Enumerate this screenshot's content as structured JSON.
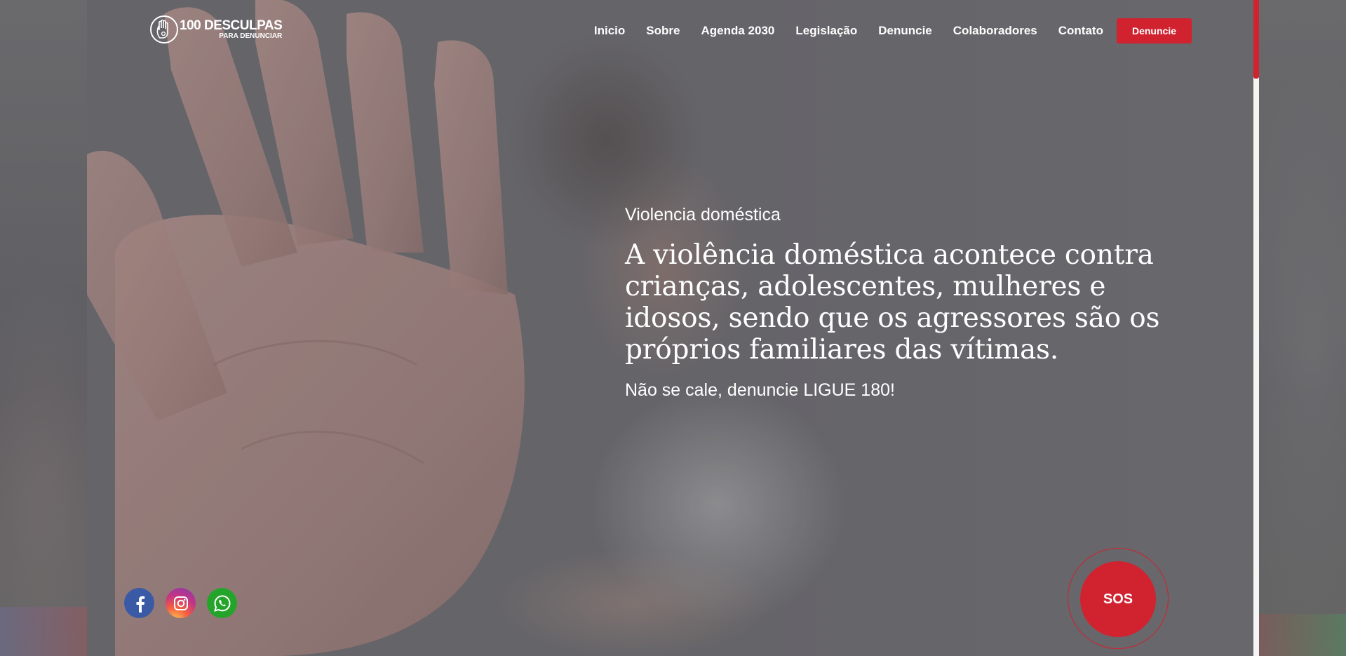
{
  "brand": {
    "title": "100 DESCULPAS",
    "subtitle": "PARA DENUNCIAR"
  },
  "nav": {
    "items": [
      {
        "label": "Inicio"
      },
      {
        "label": "Sobre"
      },
      {
        "label": "Agenda 2030"
      },
      {
        "label": "Legislação"
      },
      {
        "label": "Denuncie"
      },
      {
        "label": "Colaboradores"
      },
      {
        "label": "Contato"
      }
    ],
    "cta_label": "Denuncie"
  },
  "hero": {
    "eyebrow": "Violencia doméstica",
    "headline": "A violência doméstica acontece contra crianças, adolescentes, mulheres e idosos, sendo que os agressores são os próprios familiares das vítimas.",
    "cta_text": "Não se cale, denuncie LIGUE 180!"
  },
  "social": {
    "items": [
      {
        "icon": "facebook-icon"
      },
      {
        "icon": "instagram-icon"
      },
      {
        "icon": "whatsapp-icon"
      }
    ]
  },
  "sos": {
    "label": "SOS"
  },
  "scroll_top": {
    "icon": "arrow-up-icon"
  },
  "scrollbar": {
    "position_fraction": 0.0,
    "visible_fraction": 0.12
  },
  "colors": {
    "accent": "#d0222f",
    "facebook": "#3b5aa6",
    "whatsapp": "#25a42b",
    "scroll_top": "#22c55e"
  }
}
